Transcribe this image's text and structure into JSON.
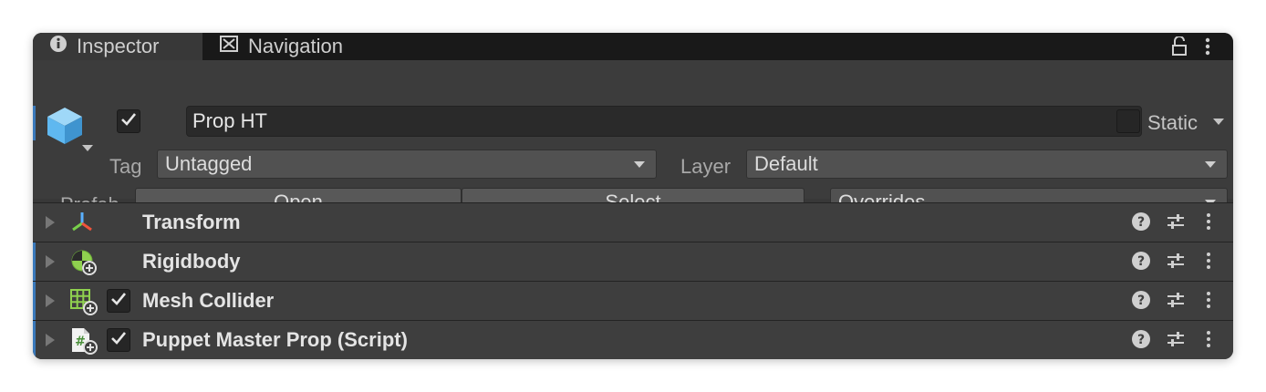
{
  "tabs": [
    {
      "label": "Inspector",
      "icon": "info-icon",
      "active": true
    },
    {
      "label": "Navigation",
      "icon": "navigation-icon",
      "active": false
    }
  ],
  "tab_menu": {
    "lock_icon": "lock-icon",
    "more_icon": "kebab-icon"
  },
  "gameobject": {
    "icon": "cube-icon",
    "active_checked": true,
    "name": "Prop HT",
    "static_checked": false,
    "static_label": "Static"
  },
  "tag": {
    "label": "Tag",
    "value": "Untagged"
  },
  "layer": {
    "label": "Layer",
    "value": "Default"
  },
  "prefab": {
    "label": "Prefab",
    "open_label": "Open",
    "select_label": "Select",
    "overrides_value": "Overrides"
  },
  "components": [
    {
      "title": "Transform",
      "icon": "transform-icon",
      "has_checkbox": false,
      "checked": null,
      "highlighted": false
    },
    {
      "title": "Rigidbody",
      "icon": "rigidbody-icon",
      "has_checkbox": false,
      "checked": null,
      "highlighted": true
    },
    {
      "title": "Mesh Collider",
      "icon": "mesh-collider-icon",
      "has_checkbox": true,
      "checked": true,
      "highlighted": true
    },
    {
      "title": "Puppet Master Prop (Script)",
      "icon": "script-icon",
      "has_checkbox": true,
      "checked": true,
      "highlighted": true
    }
  ],
  "colors": {
    "panel_bg": "#383838",
    "tab_bar_bg": "#191919",
    "accent_blue": "#3a79bb",
    "cube_blue": "#5fb8f0",
    "rigidbody_green": "#8fd14f"
  }
}
